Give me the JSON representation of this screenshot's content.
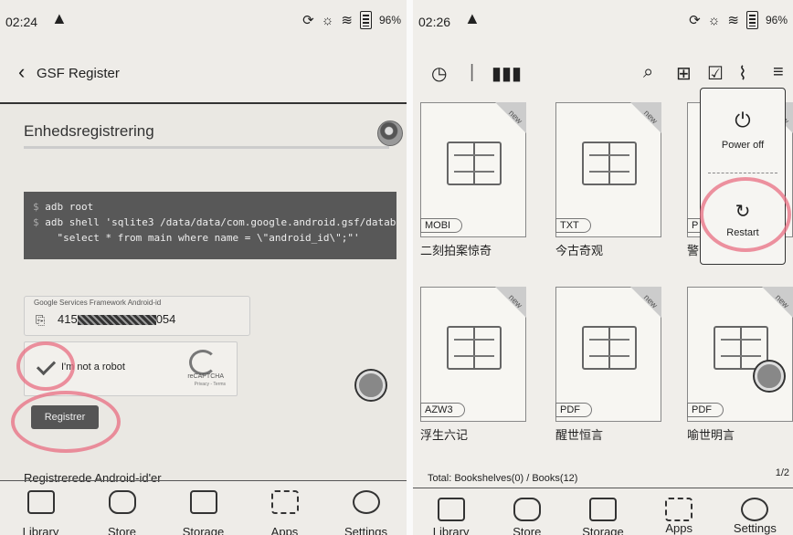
{
  "left": {
    "status": {
      "time": "02:24",
      "battery": "96%"
    },
    "header": {
      "title": "GSF Register"
    },
    "page_title": "Enhedsregistrering",
    "code": {
      "line1": "adb root",
      "line2": "adb shell 'sqlite3 /data/data/com.google.android.gsf/databa",
      "line3": "\"select * from main where name = \\\"android_id\\\";\"'"
    },
    "gsf_field": {
      "label": "Google Services Framework Android-id",
      "value_prefix": "415",
      "value_suffix": "054"
    },
    "captcha": {
      "label": "I'm not a robot",
      "brand": "reCAPTCHA",
      "links": "Privacy - Terms"
    },
    "register_button": "Registrer",
    "registered_heading": "Registrerede Android-id'er",
    "nav": [
      "Library",
      "Store",
      "Storage",
      "Apps",
      "Settings"
    ]
  },
  "right": {
    "status": {
      "time": "02:26",
      "battery": "96%"
    },
    "books": [
      {
        "title": "二刻拍案惊奇",
        "format": "MOBI",
        "new": "new"
      },
      {
        "title": "今古奇观",
        "format": "TXT",
        "new": "new"
      },
      {
        "title": "警",
        "format": "P",
        "new": "new"
      },
      {
        "title": "浮生六记",
        "format": "AZW3",
        "new": "new"
      },
      {
        "title": "醒世恒言",
        "format": "PDF",
        "new": "new"
      },
      {
        "title": "喻世明言",
        "format": "PDF",
        "new": "new"
      }
    ],
    "menu": {
      "power_off": "Power off",
      "restart": "Restart"
    },
    "total": "Total: Bookshelves(0) / Books(12)",
    "page": "1/2",
    "nav": [
      "Library",
      "Store",
      "Storage",
      "Apps",
      "Settings"
    ]
  }
}
